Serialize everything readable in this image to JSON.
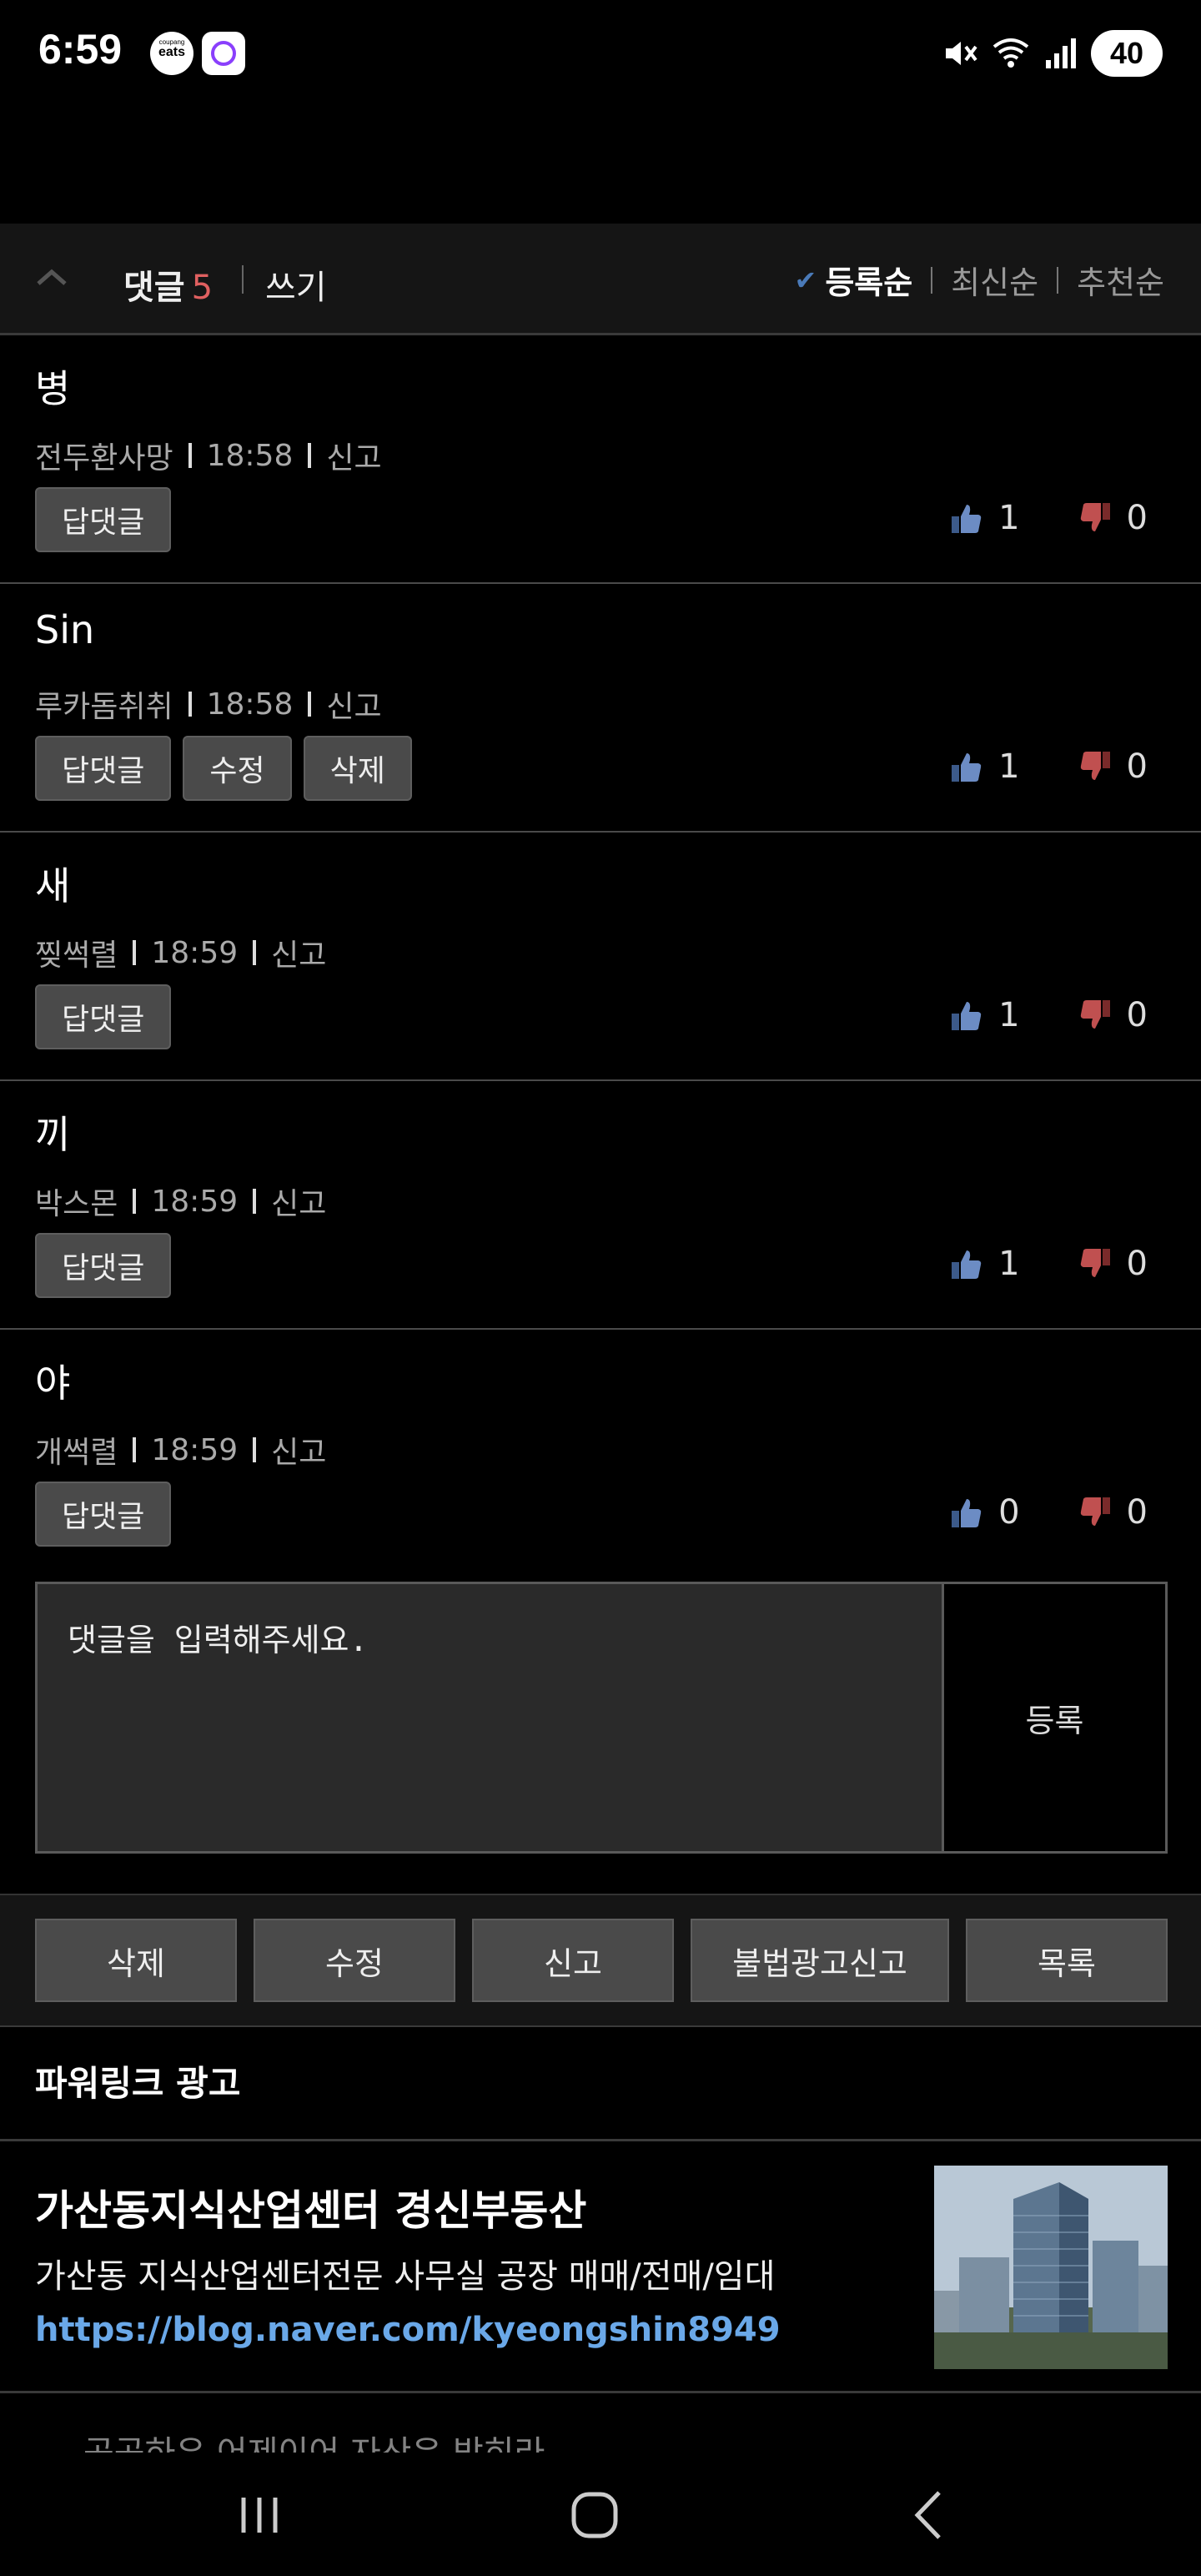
{
  "status_bar": {
    "time": "6:59",
    "app1_top": "coupang",
    "app1_label": "eats",
    "battery": "40",
    "icons": [
      "mute-icon",
      "wifi-icon",
      "signal-icon"
    ]
  },
  "comments_header": {
    "title": "댓글",
    "count": "5",
    "write_label": "쓰기",
    "sort_options": [
      "등록순",
      "최신순",
      "추천순"
    ],
    "active_sort": "등록순"
  },
  "comments": [
    {
      "body": "병",
      "author": "전두환사망",
      "time": "18:58",
      "report": "신고",
      "buttons": [
        "답댓글"
      ],
      "likes": "1",
      "dislikes": "0"
    },
    {
      "body": "Sin",
      "author": "루카돔취취",
      "time": "18:58",
      "report": "신고",
      "buttons": [
        "답댓글",
        "수정",
        "삭제"
      ],
      "likes": "1",
      "dislikes": "0"
    },
    {
      "body": "새",
      "author": "찢썩렬",
      "time": "18:59",
      "report": "신고",
      "buttons": [
        "답댓글"
      ],
      "likes": "1",
      "dislikes": "0"
    },
    {
      "body": "끼",
      "author": "박스몬",
      "time": "18:59",
      "report": "신고",
      "buttons": [
        "답댓글"
      ],
      "likes": "1",
      "dislikes": "0"
    },
    {
      "body": "야",
      "author": "개썩렬",
      "time": "18:59",
      "report": "신고",
      "buttons": [
        "답댓글"
      ],
      "likes": "0",
      "dislikes": "0"
    }
  ],
  "comment_input": {
    "placeholder": "댓글을 입력해주세요.",
    "submit_label": "등록"
  },
  "actions": [
    "삭제",
    "수정",
    "신고",
    "불법광고신고",
    "목록"
  ],
  "ads": {
    "section_title": "파워링크 광고",
    "items": [
      {
        "title": "가산동지식산업센터 경신부동산",
        "description": "가산동 지식산업센터전문 사무실 공장 매매/전매/임대",
        "url": "https://blog.naver.com/kyeongshin8949"
      }
    ],
    "next_partial": "공공하우 어제이어 자산은 밖히라"
  },
  "colors": {
    "background": "#000000",
    "panel": "#151515",
    "accent_count": "#e06060",
    "link": "#6aa8e8",
    "sort_check": "#4a7ab8"
  }
}
